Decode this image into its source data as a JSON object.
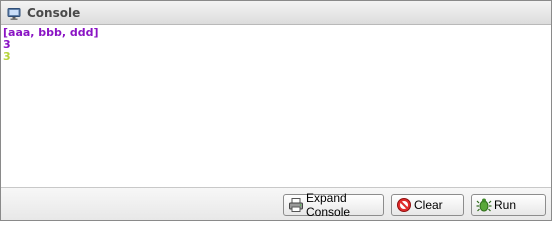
{
  "window": {
    "title": "Console",
    "icon": "monitor-icon"
  },
  "console": {
    "lines": [
      {
        "text": "[aaa, bbb, ddd]",
        "color": "#8a14c4"
      },
      {
        "text": "3",
        "color": "#8a14c4"
      },
      {
        "text": "3",
        "color": "#b6d43a"
      }
    ]
  },
  "footer": {
    "expand_label": "Expand Console",
    "expand_icon": "printer-icon",
    "clear_label": "Clear",
    "clear_icon": "no-entry-icon",
    "run_label": "Run",
    "run_icon": "bug-icon"
  }
}
